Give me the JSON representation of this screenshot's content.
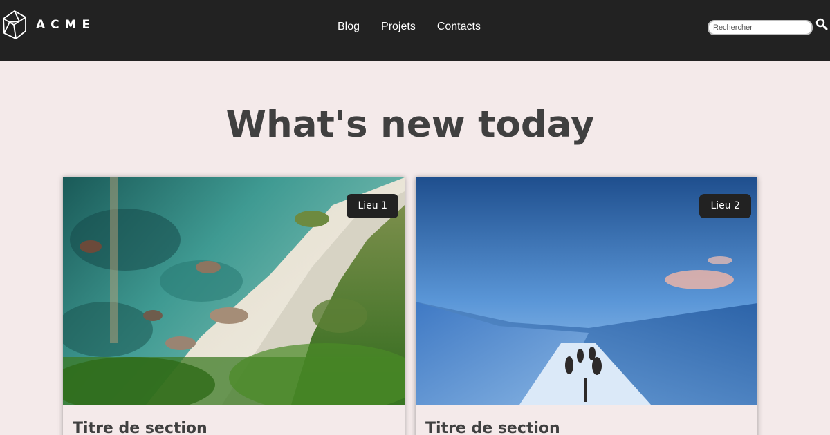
{
  "header": {
    "brand": "ACME",
    "nav": [
      {
        "label": "Blog"
      },
      {
        "label": "Projets"
      },
      {
        "label": "Contacts"
      }
    ],
    "search": {
      "placeholder": "Rechercher",
      "icon": "search-icon"
    }
  },
  "main": {
    "title": "What's new today",
    "cards": [
      {
        "badge": "Lieu 1",
        "title": "Titre de section",
        "image": "coastal-cliff-photo"
      },
      {
        "badge": "Lieu 2",
        "title": "Titre de section",
        "image": "snow-dog-sled-photo"
      }
    ]
  },
  "colors": {
    "navbar": "#222222",
    "page_background": "#f4eaea",
    "title_text": "#404040",
    "badge_background": "#222222"
  }
}
